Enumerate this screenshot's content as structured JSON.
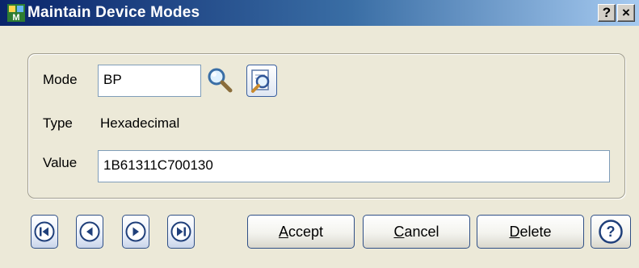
{
  "window": {
    "title": "Maintain Device Modes",
    "help_glyph": "?",
    "close_glyph": "×"
  },
  "form": {
    "mode_label": "Mode",
    "mode_value": "BP",
    "type_label": "Type",
    "type_value": "Hexadecimal",
    "value_label": "Value",
    "value_value": "1B61311C700130"
  },
  "buttons": {
    "accept": {
      "hotkey": "A",
      "rest": "ccept"
    },
    "cancel": {
      "hotkey": "C",
      "rest": "ancel"
    },
    "delete": {
      "hotkey": "D",
      "rest": "elete"
    }
  },
  "icons": {
    "app": "app-icon",
    "lookup": "magnifier-icon",
    "zoom": "zoom-browse-icon",
    "first": "first-record-icon",
    "prev": "previous-record-icon",
    "next": "next-record-icon",
    "last": "last-record-icon",
    "help": "help-icon"
  },
  "colors": {
    "title_start": "#0a246a",
    "title_end": "#a6caf0",
    "face": "#ece9d8",
    "button_border": "#2f4f86",
    "nav_icon": "#1f3f7a"
  }
}
